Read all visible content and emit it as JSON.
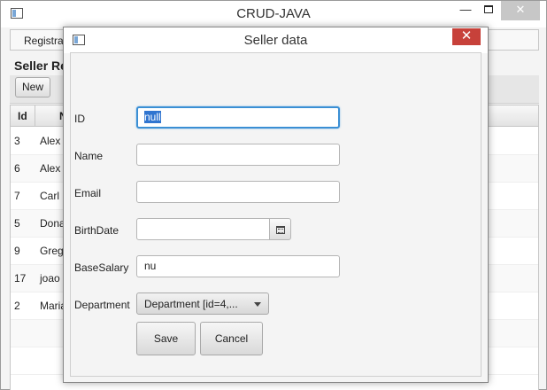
{
  "main_window": {
    "title": "CRUD-JAVA",
    "min_glyph": "—",
    "close_glyph": "✕",
    "menu": {
      "registration_label": "Registrat"
    },
    "section_title": "Seller Re",
    "new_button_label": "New",
    "table": {
      "headers": {
        "id": "Id",
        "name": "N"
      },
      "rows": [
        {
          "id": "3",
          "name": "Alex"
        },
        {
          "id": "6",
          "name": "Alex"
        },
        {
          "id": "7",
          "name": "Carl F"
        },
        {
          "id": "5",
          "name": "Dona"
        },
        {
          "id": "9",
          "name": "Greg"
        },
        {
          "id": "17",
          "name": "joao"
        },
        {
          "id": "2",
          "name": "Maria"
        }
      ]
    },
    "bottom_text": "..."
  },
  "dialog": {
    "title": "Seller data",
    "close_glyph": "✕",
    "fields": {
      "id": {
        "label": "ID",
        "value": "null"
      },
      "name": {
        "label": "Name",
        "value": ""
      },
      "email": {
        "label": "Email",
        "value": ""
      },
      "birthdate": {
        "label": "BirthDate",
        "value": ""
      },
      "base_salary": {
        "label": "BaseSalary",
        "value": "nu"
      },
      "department": {
        "label": "Department",
        "value": "Department [id=4,..."
      }
    },
    "save_label": "Save",
    "cancel_label": "Cancel"
  },
  "colors": {
    "focus_border": "#3b8fd4",
    "selection": "#3075d0",
    "dialog_close": "#c7413a"
  }
}
